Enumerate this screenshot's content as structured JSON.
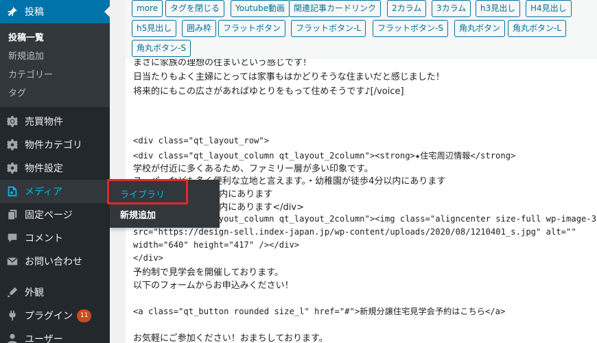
{
  "sidebar": {
    "posts": {
      "label": "投稿",
      "submenu": [
        {
          "label": "投稿一覧",
          "current": true
        },
        {
          "label": "新規追加"
        },
        {
          "label": "カテゴリー"
        },
        {
          "label": "タグ"
        }
      ]
    },
    "items": [
      {
        "label": "売買物件",
        "icon": "gear-icon"
      },
      {
        "label": "物件カテゴリ",
        "icon": "gear-icon"
      },
      {
        "label": "物件設定",
        "icon": "gear-icon"
      },
      {
        "label": "メディア",
        "icon": "media-icon"
      },
      {
        "label": "固定ページ",
        "icon": "pages-icon"
      },
      {
        "label": "コメント",
        "icon": "comment-icon"
      },
      {
        "label": "お問い合わせ",
        "icon": "mail-icon"
      },
      {
        "label": "外観",
        "icon": "appearance-icon"
      },
      {
        "label": "プラグイン",
        "icon": "plugin-icon",
        "badge": "11"
      },
      {
        "label": "ユーザー",
        "icon": "user-icon"
      }
    ]
  },
  "flyout": {
    "library": "ライブラリ",
    "add_new": "新規追加"
  },
  "toolbar": {
    "buttons": [
      "more",
      "タグを閉じる",
      "Youtube動画",
      "関連記事カードリンク",
      "2カラム",
      "3カラム",
      "h3見出し",
      "H4見出し",
      "h5見出し",
      "囲み枠",
      "フラットボタン",
      "フラットボタン-L",
      "フラットボタン-S",
      "角丸ボタン",
      "角丸ボタン-L",
      "角丸ボタン-S"
    ]
  },
  "editor": {
    "lines": [
      "まさに家族の理想の住まいという感じです！",
      "日当たりもよく主婦にとっては家事もはかどりそうな住まいだと感じました！",
      "将来的にもこの広さがあればゆとりをもって住めそうです♪[/voice]",
      "<div class=\"qt_layout_row\">",
      "<div class=\"qt_layout_column qt_layout_2column\"><strong>★住宅周辺情報</strong>",
      "学校が付近に多くあるため、ファミリー層が多い印象です。",
      "スーパーなども多く便利な立地と言えます。・幼稚園が徒歩4分以内にあります",
      "・小学校が徒歩5分以内にあります",
      "・中学校が徒歩6分以内にあります</div>",
      "<div class=\"qt_layout_column qt_layout_2column\"><img class=\"aligncenter size-full wp-image-3069\"",
      "src=\"https://design-sell.index-japan.jp/wp-content/uploads/2020/08/1210401_s.jpg\" alt=\"\"",
      "width=\"640\" height=\"417\" /></div>",
      "</div>",
      "予約制で見学会を開催しております。",
      "以下のフォームからお申込みください！",
      "<a class=\"qt_button rounded size_l\" href=\"#\">新規分譲住宅見学会予約はこちら</a>",
      "お気軽にご参加ください！おまちしております。"
    ]
  },
  "colors": {
    "sidebar_bg": "#23282d",
    "active_menu": "#0073aa",
    "submenu_bg": "#32373c",
    "highlight_box": "#e02b27",
    "toolbar_button": "#0071a1"
  }
}
